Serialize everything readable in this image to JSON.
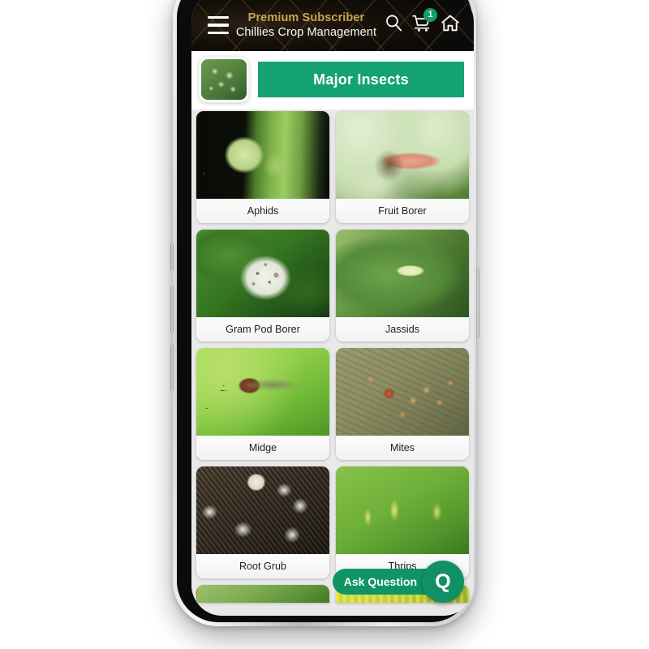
{
  "app": {
    "header": {
      "menu_icon": "hamburger-menu-icon",
      "premium_label": "Premium Subscriber",
      "crop_title": "Chillies Crop Management",
      "search_icon": "search-icon",
      "cart_icon": "shopping-cart-icon",
      "cart_badge": "1",
      "home_icon": "home-icon",
      "premium_color": "#c9a356",
      "background_color": "#0d0c09"
    },
    "banner": {
      "thumbnail_name": "crop-thumbnail",
      "title": "Major Insects",
      "accent_color": "#14a173"
    },
    "grid": {
      "cards": [
        {
          "label": "Aphids",
          "image": "aphids-photo",
          "photo_class": "ph-aphids"
        },
        {
          "label": "Fruit Borer",
          "image": "fruit-borer-photo",
          "photo_class": "ph-fruitborer"
        },
        {
          "label": "Gram Pod Borer",
          "image": "gram-pod-borer-photo",
          "photo_class": "ph-grampodborer"
        },
        {
          "label": "Jassids",
          "image": "jassids-photo",
          "photo_class": "ph-jassids"
        },
        {
          "label": "Midge",
          "image": "midge-photo",
          "photo_class": "ph-midge"
        },
        {
          "label": "Mites",
          "image": "mites-photo",
          "photo_class": "ph-mites"
        },
        {
          "label": "Root Grub",
          "image": "root-grub-photo",
          "photo_class": "ph-rootgrub"
        },
        {
          "label": "Thrips",
          "image": "thrips-photo",
          "photo_class": "ph-thrips"
        }
      ]
    },
    "fab": {
      "label": "Ask Question",
      "initial": "Q",
      "color": "#0f9565"
    }
  }
}
